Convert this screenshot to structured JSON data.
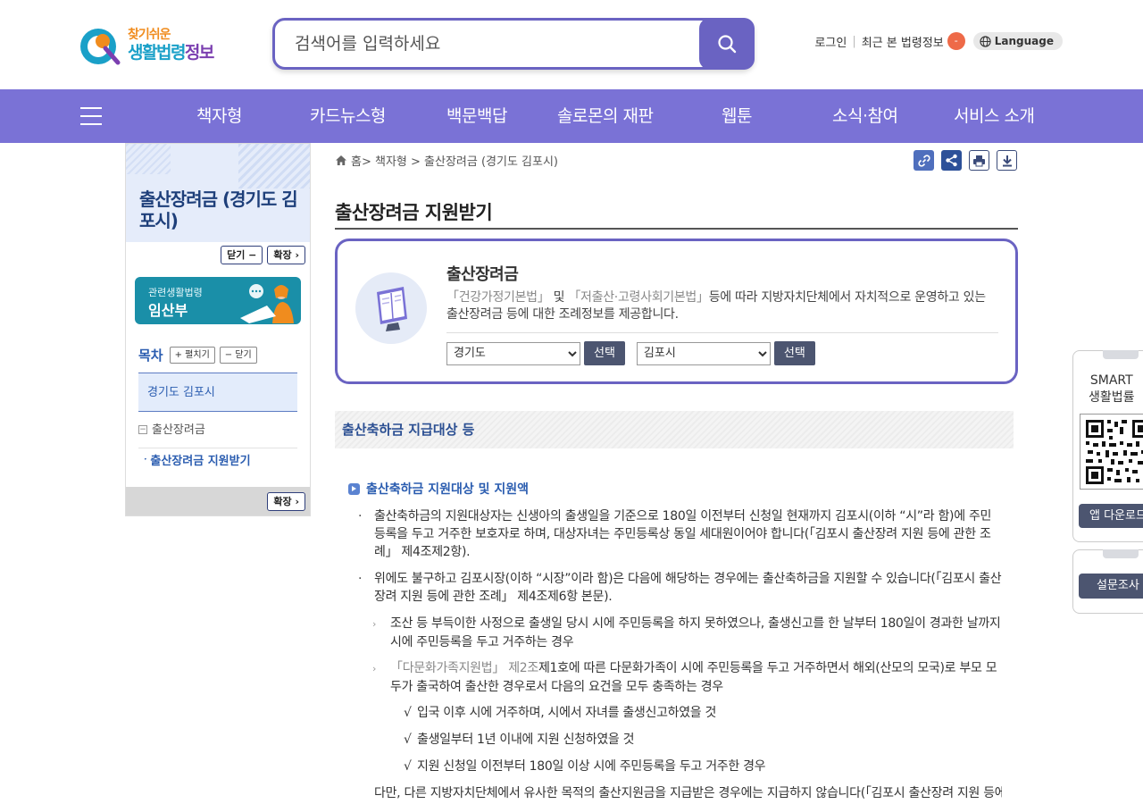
{
  "header": {
    "logo_sub": "찾기쉬운",
    "logo_main_a": "생활법령",
    "logo_main_b": "정보",
    "search_placeholder": "검색어를 입력하세요",
    "login": "로그인",
    "recent": "최근 본 법령정보",
    "recent_badge": "-",
    "language": "Language"
  },
  "nav": {
    "items": [
      "책자형",
      "카드뉴스형",
      "백문백답",
      "솔로몬의 재판",
      "웹툰",
      "소식·참여",
      "서비스 소개"
    ]
  },
  "sidebar": {
    "title": "출산장려금 (경기도 김포시)",
    "close_btn": "닫기 −",
    "expand_btn": "확장 ›",
    "related_sub": "관련생활법령",
    "related_main": "임산부",
    "toc_title": "목차",
    "toc_expand": "+ 펼치기",
    "toc_collapse": "− 닫기",
    "toc_items": [
      "경기도 김포시",
      "출산장려금",
      "출산장려금 지원받기"
    ],
    "foot_expand": "확장 ›"
  },
  "breadcrumb": {
    "home": "홈",
    "path": " > 책자형 > 출산장려금 (경기도 김포시)"
  },
  "page": {
    "title": "출산장려금 지원받기"
  },
  "card": {
    "name": "출산장려금",
    "desc_law1": "「건강가정기본법」",
    "desc_mid": " 및 ",
    "desc_law2": "「저출산·고령사회기본법」",
    "desc_rest": "등에 따라 지방자치단체에서 자치적으로 운영하고 있는 출산장려금 등에 대한 조례정보를 제공합니다.",
    "select1": "경기도",
    "select2": "김포시",
    "select_btn": "선택"
  },
  "section": {
    "heading": "출산축하금 지급대상 등",
    "sub_heading": "출산축하금 지원대상 및 지원액",
    "p1": "출산축하금의 지원대상자는 신생아의 출생일을 기준으로 180일 이전부터 신청일 현재까지 김포시(이하 “시”라 함)에 주민등록을 두고 거주한 보호자로 하며, 대상자녀는 주민등록상 동일 세대원이어야 합니다(「김포시 출산장려 지원 등에 관한 조례」 제4조제2항).",
    "p2": "위에도 불구하고 김포시장(이하 “시장”이라 함)은 다음에 해당하는 경우에는 출산축하금을 지원할 수 있습니다(「김포시 출산장려 지원 등에 관한 조례」 제4조제6항 본문).",
    "p3": "조산 등 부득이한 사정으로 출생일 당시 시에 주민등록을 하지 못하였으나, 출생신고를 한 날부터 180일이 경과한 날까지 시에 주민등록을 두고 거주하는 경우",
    "p4_law": "「다문화가족지원법」 제2조",
    "p4_rest": "제1호에 따른 다문화가족이 시에 주민등록을 두고 거주하면서 해외(산모의 모국)로 부모 모두가 출국하여 출산한 경우로서 다음의 요건을 모두 충족하는 경우",
    "c1": "입국 이후 시에 거주하며, 시에서 자녀를 출생신고하였을 것",
    "c2": "출생일부터 1년 이내에 지원 신청하였을 것",
    "c3": "지원 신청일 이전부터 180일 이상 시에 주민등록을 두고 거주한 경우",
    "p5": "다만, 다른 지방자치단체에서 유사한 목적의 출산지원금을 지급받은 경우에는 지급하지 않습니다(「김포시 출산장려 지원 등에"
  },
  "widgets": {
    "qr_title_1": "SMART",
    "qr_title_2": "생활법률",
    "app_download": "앱 다운로드",
    "survey": "설문조사"
  },
  "colors": {
    "brand": "#7a72d6",
    "accent": "#6a63c2",
    "link": "#2b5db0"
  }
}
